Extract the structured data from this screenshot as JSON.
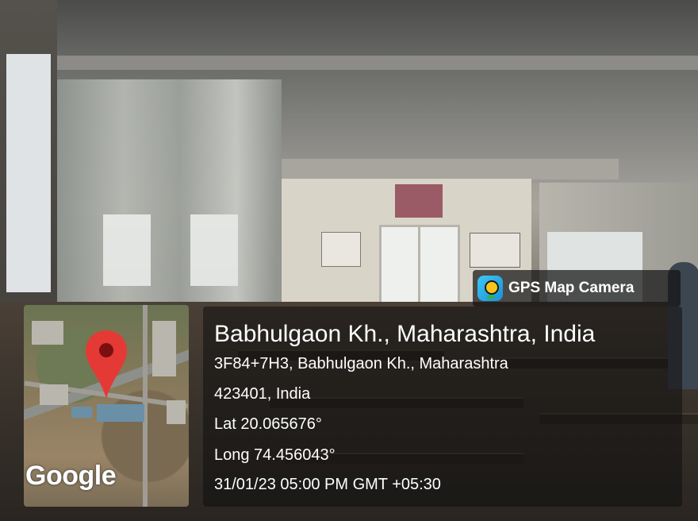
{
  "overlay": {
    "app_name": "GPS Map Camera",
    "location_title": "Babhulgaon Kh., Maharashtra, India",
    "address_line1": "3F84+7H3, Babhulgaon Kh., Maharashtra",
    "address_line2": "423401, India",
    "latitude": "Lat 20.065676°",
    "longitude": "Long 74.456043°",
    "datetime": "31/01/23 05:00 PM GMT +05:30",
    "map_attribution": "Google"
  },
  "icons": {
    "app_icon": "gps-map-camera-app-icon",
    "location_pin": "map-pin-icon"
  },
  "colors": {
    "pin": "#e53935",
    "panel_bg": "rgba(15,15,15,0.55)",
    "text": "#ffffff"
  }
}
